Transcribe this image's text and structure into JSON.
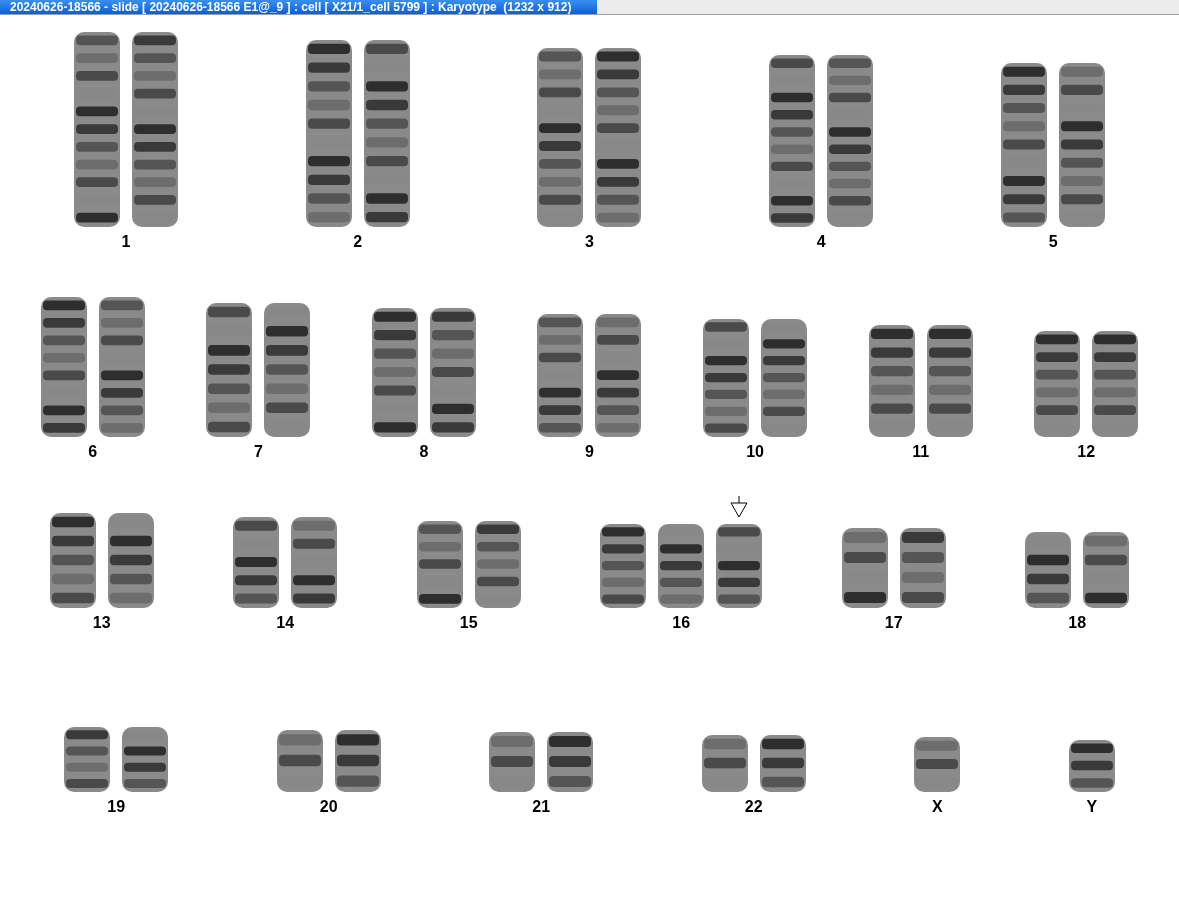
{
  "window": {
    "title": "20240626-18566 - slide [ 20240626-18566 E1@_9 ] : cell [ X21/1_cell 5799 ] : Karyotype  (1232 x 912)"
  },
  "rows": [
    {
      "groups": [
        {
          "label": "1",
          "chromosomes": [
            {
              "marked": false
            },
            {
              "marked": false
            }
          ]
        },
        {
          "label": "2",
          "chromosomes": [
            {
              "marked": false
            },
            {
              "marked": false
            }
          ]
        },
        {
          "label": "3",
          "chromosomes": [
            {
              "marked": false
            },
            {
              "marked": false
            }
          ]
        },
        {
          "label": "4",
          "chromosomes": [
            {
              "marked": false
            },
            {
              "marked": false
            }
          ]
        },
        {
          "label": "5",
          "chromosomes": [
            {
              "marked": false
            },
            {
              "marked": false
            }
          ]
        }
      ]
    },
    {
      "groups": [
        {
          "label": "6",
          "chromosomes": [
            {
              "marked": false
            },
            {
              "marked": false
            }
          ]
        },
        {
          "label": "7",
          "chromosomes": [
            {
              "marked": false
            },
            {
              "marked": false
            }
          ]
        },
        {
          "label": "8",
          "chromosomes": [
            {
              "marked": false
            },
            {
              "marked": false
            }
          ]
        },
        {
          "label": "9",
          "chromosomes": [
            {
              "marked": false
            },
            {
              "marked": false
            }
          ]
        },
        {
          "label": "10",
          "chromosomes": [
            {
              "marked": false
            },
            {
              "marked": false
            }
          ]
        },
        {
          "label": "11",
          "chromosomes": [
            {
              "marked": false
            },
            {
              "marked": false
            }
          ]
        },
        {
          "label": "12",
          "chromosomes": [
            {
              "marked": false
            },
            {
              "marked": false
            }
          ]
        }
      ]
    },
    {
      "groups": [
        {
          "label": "13",
          "chromosomes": [
            {
              "marked": false
            },
            {
              "marked": false
            }
          ]
        },
        {
          "label": "14",
          "chromosomes": [
            {
              "marked": false
            },
            {
              "marked": false
            }
          ]
        },
        {
          "label": "15",
          "chromosomes": [
            {
              "marked": false
            },
            {
              "marked": false
            }
          ]
        },
        {
          "label": "16",
          "chromosomes": [
            {
              "marked": false
            },
            {
              "marked": false
            },
            {
              "marked": true
            }
          ]
        },
        {
          "label": "17",
          "chromosomes": [
            {
              "marked": false
            },
            {
              "marked": false
            }
          ]
        },
        {
          "label": "18",
          "chromosomes": [
            {
              "marked": false
            },
            {
              "marked": false
            }
          ]
        }
      ]
    },
    {
      "groups": [
        {
          "label": "19",
          "chromosomes": [
            {
              "marked": false
            },
            {
              "marked": false
            }
          ]
        },
        {
          "label": "20",
          "chromosomes": [
            {
              "marked": false
            },
            {
              "marked": false
            }
          ]
        },
        {
          "label": "21",
          "chromosomes": [
            {
              "marked": false
            },
            {
              "marked": false
            }
          ]
        },
        {
          "label": "22",
          "chromosomes": [
            {
              "marked": false
            },
            {
              "marked": false
            }
          ]
        },
        {
          "label": "X",
          "chromosomes": [
            {
              "marked": false
            }
          ]
        },
        {
          "label": "Y",
          "chromosomes": [
            {
              "marked": false
            }
          ]
        }
      ]
    }
  ]
}
